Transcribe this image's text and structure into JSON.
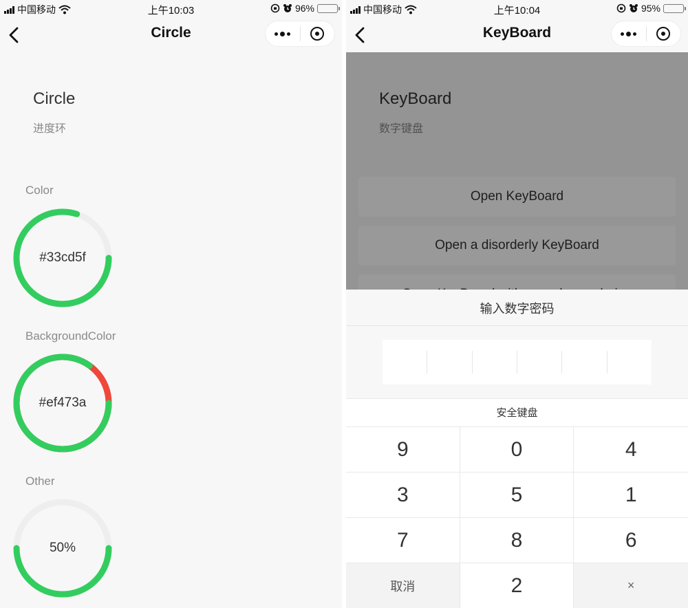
{
  "left": {
    "status": {
      "carrier": "中国移动",
      "time": "上午10:03",
      "battery": "96%",
      "battery_level": 0.96
    },
    "nav": {
      "title": "Circle"
    },
    "page": {
      "title": "Circle",
      "subtitle": "进度环"
    },
    "sections": [
      {
        "label": "Color",
        "ring_text": "#33cd5f",
        "progress": 0.8,
        "track_color": "#eeeeee",
        "progress_color": "#33cd5f"
      },
      {
        "label": "BackgroundColor",
        "ring_text": "#ef473a",
        "progress": 0.85,
        "track_color": "#ef473a",
        "progress_color": "#33cd5f"
      },
      {
        "label": "Other",
        "ring_text": "50%",
        "progress": 0.5,
        "track_color": "#eeeeee",
        "progress_color": "#33cd5f"
      }
    ]
  },
  "right": {
    "status": {
      "carrier": "中国移动",
      "time": "上午10:04",
      "battery": "95%",
      "battery_level": 0.95
    },
    "nav": {
      "title": "KeyBoard"
    },
    "page": {
      "title": "KeyBoard",
      "subtitle": "数字键盘"
    },
    "buttons": [
      "Open KeyBoard",
      "Open a disorderly KeyBoard",
      "Open KeyBoard with a random ordering"
    ],
    "sheet": {
      "title": "输入数字密码",
      "keyboard_title": "安全键盘",
      "keys": [
        "9",
        "0",
        "4",
        "3",
        "5",
        "1",
        "7",
        "8",
        "6",
        "取消",
        "2",
        "×"
      ]
    }
  },
  "colors": {
    "accent_green": "#33cd5f",
    "accent_red": "#ef473a",
    "battery_yellow": "#f5c518"
  }
}
